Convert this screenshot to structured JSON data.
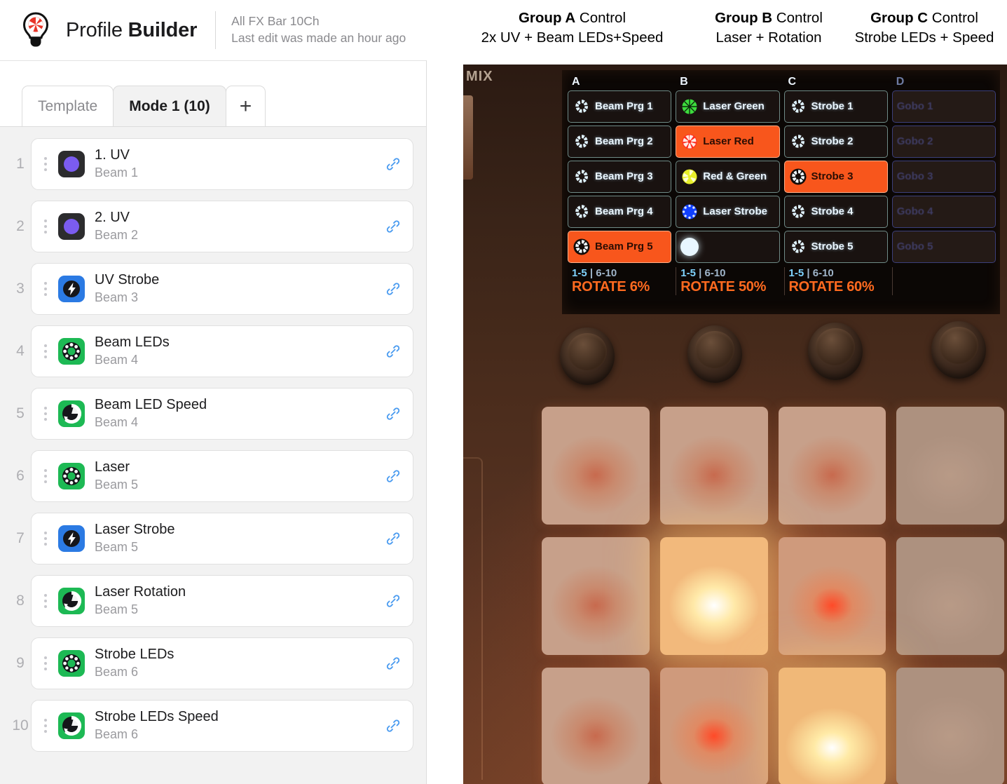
{
  "app": {
    "logo_icon": "lightbulb-aperture-icon",
    "title_light": "Profile ",
    "title_bold": "Builder",
    "profile_name": "All FX Bar 10Ch",
    "last_edit": "Last edit was made an hour ago"
  },
  "tabs": [
    {
      "label": "Template",
      "active": false
    },
    {
      "label": "Mode 1 (10)",
      "active": true
    },
    {
      "label": "+",
      "active": false
    }
  ],
  "channels": [
    {
      "index": "1",
      "name": "1. UV",
      "beam": "Beam 1",
      "icon": "uv-circle-icon",
      "icon_kind": "uv",
      "link_icon": "link-icon"
    },
    {
      "index": "2",
      "name": "2. UV",
      "beam": "Beam 2",
      "icon": "uv-circle-icon",
      "icon_kind": "uv",
      "link_icon": "link-icon"
    },
    {
      "index": "3",
      "name": "UV Strobe",
      "beam": "Beam 3",
      "icon": "strobe-bolt-icon",
      "icon_kind": "strobe",
      "link_icon": "link-icon"
    },
    {
      "index": "4",
      "name": "Beam LEDs",
      "beam": "Beam 4",
      "icon": "gobo-wheel-icon",
      "icon_kind": "gobo",
      "link_icon": "link-icon"
    },
    {
      "index": "5",
      "name": "Beam LED Speed",
      "beam": "Beam 4",
      "icon": "gobo-rotation-icon",
      "icon_kind": "speed",
      "link_icon": "link-icon"
    },
    {
      "index": "6",
      "name": "Laser",
      "beam": "Beam 5",
      "icon": "gobo-wheel-icon",
      "icon_kind": "gobo",
      "link_icon": "link-icon"
    },
    {
      "index": "7",
      "name": "Laser Strobe",
      "beam": "Beam 5",
      "icon": "strobe-bolt-icon",
      "icon_kind": "strobe",
      "link_icon": "link-icon"
    },
    {
      "index": "8",
      "name": "Laser Rotation",
      "beam": "Beam 5",
      "icon": "gobo-rotation-icon",
      "icon_kind": "speed",
      "link_icon": "link-icon"
    },
    {
      "index": "9",
      "name": "Strobe LEDs",
      "beam": "Beam 6",
      "icon": "gobo-wheel-icon",
      "icon_kind": "gobo",
      "link_icon": "link-icon"
    },
    {
      "index": "10",
      "name": "Strobe LEDs Speed",
      "beam": "Beam 6",
      "icon": "gobo-rotation-icon",
      "icon_kind": "speed",
      "link_icon": "link-icon"
    }
  ],
  "annotations": [
    {
      "bold": "Group A",
      "rest": " Control",
      "line2": "2x UV + Beam LEDs+Speed"
    },
    {
      "bold": "Group B",
      "rest": " Control",
      "line2": "Laser + Rotation"
    },
    {
      "bold": "Group C",
      "rest": " Control",
      "line2": "Strobe LEDs  + Speed"
    }
  ],
  "device": {
    "mix_label": "MIX",
    "lcd": {
      "columns": [
        {
          "head": "A",
          "dim": false
        },
        {
          "head": "B",
          "dim": false
        },
        {
          "head": "C",
          "dim": false
        },
        {
          "head": "D",
          "dim": true
        }
      ],
      "cells": {
        "A": [
          {
            "label": "Beam Prg 1",
            "selected": false,
            "icon": "gobo-icon",
            "icon_color": "#ffffff"
          },
          {
            "label": "Beam Prg 2",
            "selected": false,
            "icon": "gobo-icon",
            "icon_color": "#ffffff"
          },
          {
            "label": "Beam Prg 3",
            "selected": false,
            "icon": "gobo-icon",
            "icon_color": "#ffffff"
          },
          {
            "label": "Beam Prg 4",
            "selected": false,
            "icon": "gobo-icon",
            "icon_color": "#ffffff"
          },
          {
            "label": "Beam Prg 5",
            "selected": true,
            "icon": "gobo-icon",
            "icon_color": "#ffffff"
          }
        ],
        "B": [
          {
            "label": "Laser Green",
            "selected": false,
            "icon": "color-wheel-icon",
            "icon_color": "#3ddb3d"
          },
          {
            "label": "Laser Red",
            "selected": true,
            "icon": "color-wheel-icon",
            "icon_color": "#ff3b30"
          },
          {
            "label": "Red & Green",
            "selected": false,
            "icon": "color-wheel-icon",
            "icon_color": "#e8ef2a"
          },
          {
            "label": "Laser Strobe",
            "selected": false,
            "icon": "dot-ring-icon",
            "icon_color": "#1f6bff"
          },
          {
            "label": "",
            "selected": false,
            "icon": "white-dot-icon",
            "icon_color": "#e8f6ff"
          }
        ],
        "C": [
          {
            "label": "Strobe 1",
            "selected": false,
            "icon": "gobo-icon",
            "icon_color": "#ffffff"
          },
          {
            "label": "Strobe 2",
            "selected": false,
            "icon": "gobo-icon",
            "icon_color": "#ffffff"
          },
          {
            "label": "Strobe 3",
            "selected": true,
            "icon": "gobo-icon",
            "icon_color": "#ffffff"
          },
          {
            "label": "Strobe 4",
            "selected": false,
            "icon": "gobo-icon",
            "icon_color": "#ffffff"
          },
          {
            "label": "Strobe 5",
            "selected": false,
            "icon": "gobo-icon",
            "icon_color": "#ffffff"
          }
        ],
        "D": [
          {
            "label": "Gobo 1",
            "selected": false,
            "icon": "none",
            "icon_color": "#4d4f8e"
          },
          {
            "label": "Gobo 2",
            "selected": false,
            "icon": "none",
            "icon_color": "#4d4f8e"
          },
          {
            "label": "Gobo 3",
            "selected": false,
            "icon": "none",
            "icon_color": "#4d4f8e"
          },
          {
            "label": "Gobo 4",
            "selected": false,
            "icon": "none",
            "icon_color": "#4d4f8e"
          },
          {
            "label": "Gobo 5",
            "selected": false,
            "icon": "none",
            "icon_color": "#4d4f8e"
          }
        ]
      },
      "footers": [
        {
          "range_sel": "1-5",
          "range_alt": "6-10",
          "rotate": "ROTATE 6%"
        },
        {
          "range_sel": "1-5",
          "range_alt": "6-10",
          "rotate": "ROTATE 50%"
        },
        {
          "range_sel": "1-5",
          "range_alt": "6-10",
          "rotate": "ROTATE 60%"
        },
        {
          "range_sel": "",
          "range_alt": "",
          "rotate": ""
        }
      ]
    },
    "knob_count": 4,
    "pads": [
      [
        "dim",
        "dim",
        "dim",
        "off"
      ],
      [
        "dim",
        "bright",
        "lit",
        "off"
      ],
      [
        "dim",
        "lit",
        "bright",
        "off"
      ]
    ]
  },
  "colors": {
    "accent_orange": "#f8561c",
    "accent_blue": "#2b7ae3",
    "accent_green": "#1db954",
    "uv_purple": "#7b5cf0",
    "link_blue": "#4a9bf0"
  }
}
